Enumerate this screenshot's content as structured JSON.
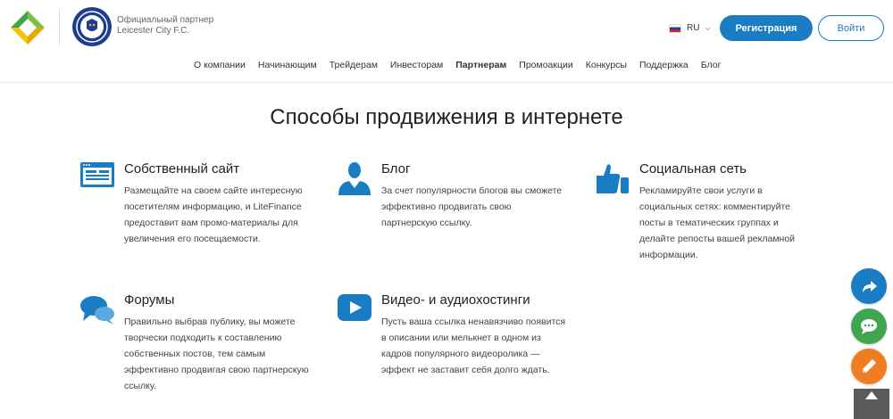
{
  "header": {
    "partner_line1": "Официальный партнер",
    "partner_line2": "Leicester City F.C.",
    "lang": "RU",
    "register_label": "Регистрация",
    "login_label": "Войти"
  },
  "nav": {
    "items": [
      {
        "label": "О компании"
      },
      {
        "label": "Начинающим"
      },
      {
        "label": "Трейдерам"
      },
      {
        "label": "Инвесторам"
      },
      {
        "label": "Партнерам",
        "active": true
      },
      {
        "label": "Промоакции"
      },
      {
        "label": "Конкурсы"
      },
      {
        "label": "Поддержка"
      },
      {
        "label": "Блог"
      }
    ]
  },
  "main": {
    "title": "Способы продвижения в интернете",
    "features": [
      {
        "icon": "website-icon",
        "title": "Собственный сайт",
        "text": "Размещайте на своем сайте интересную посетителям информацию, и LiteFinance предоставит вам промо-материалы для увеличения его посещаемости."
      },
      {
        "icon": "blogger-icon",
        "title": "Блог",
        "text": "За счет популярности блогов вы сможете эффективно продвигать свою партнерскую ссылку."
      },
      {
        "icon": "thumbs-up-icon",
        "title": "Социальная сеть",
        "text": "Рекламируйте свои услуги в социальных сетях: комментируйте посты в тематических группах и делайте репосты вашей рекламной информации."
      },
      {
        "icon": "chat-bubbles-icon",
        "title": "Форумы",
        "text": "Правильно выбрав публику, вы можете творчески подходить к составлению собственных постов, тем самым эффективно продвигая свою партнерскую ссылку."
      },
      {
        "icon": "play-icon",
        "title": "Видео- и аудиохостинги",
        "text": "Пусть ваша ссылка ненавязчиво появится в описании или мелькнет в одном из кадров популярного видеоролика — эффект не заставит себя долго ждать."
      }
    ]
  },
  "colors": {
    "accent": "#1a7dc4",
    "chat": "#3fa64f",
    "edit": "#ef7d22",
    "scroll": "#5b5b5b"
  }
}
